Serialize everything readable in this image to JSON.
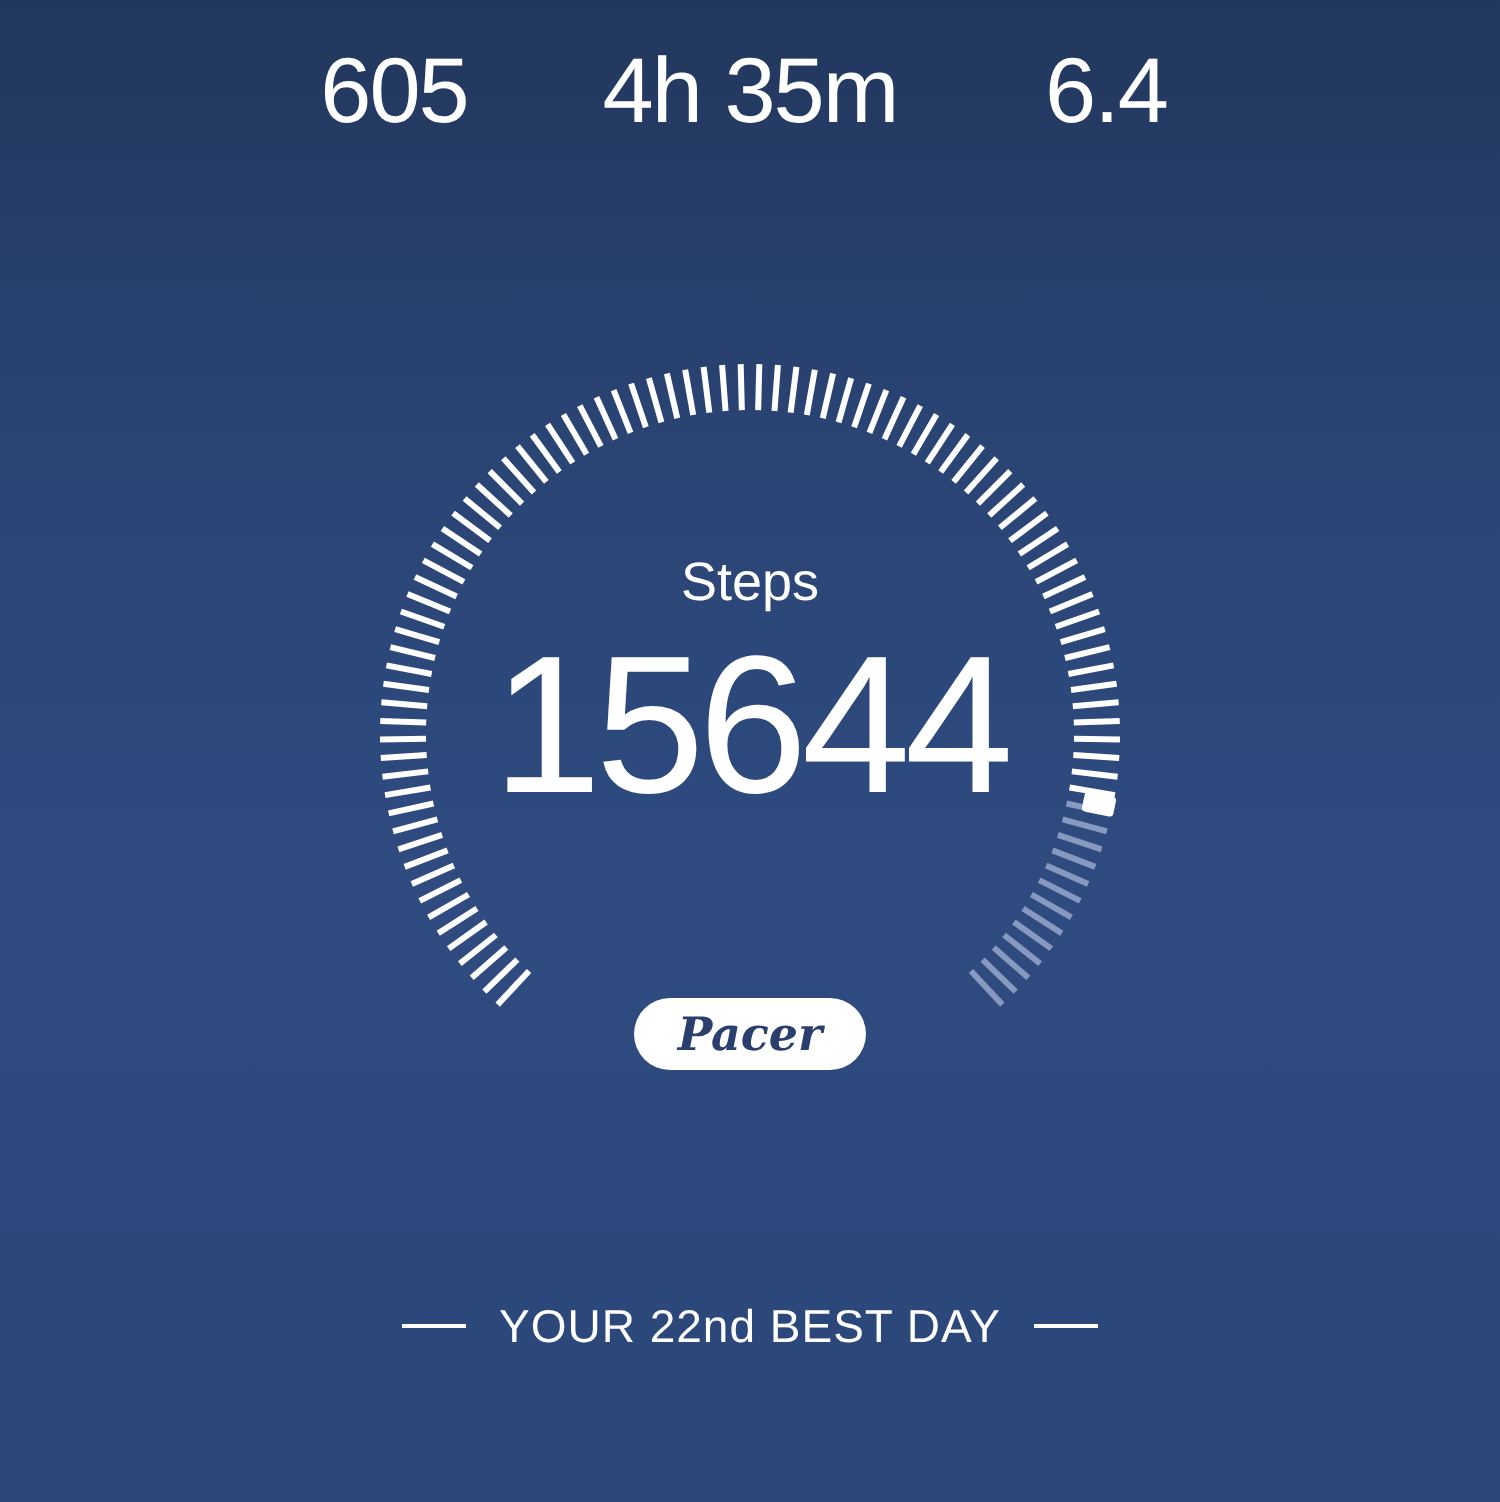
{
  "stats": [
    {
      "value": "605"
    },
    {
      "value": "4h 35m"
    },
    {
      "value": "6.4"
    }
  ],
  "gauge": {
    "label": "Steps",
    "value": "15644"
  },
  "brand": "Pacer",
  "footer": "YOUR 22nd BEST DAY"
}
